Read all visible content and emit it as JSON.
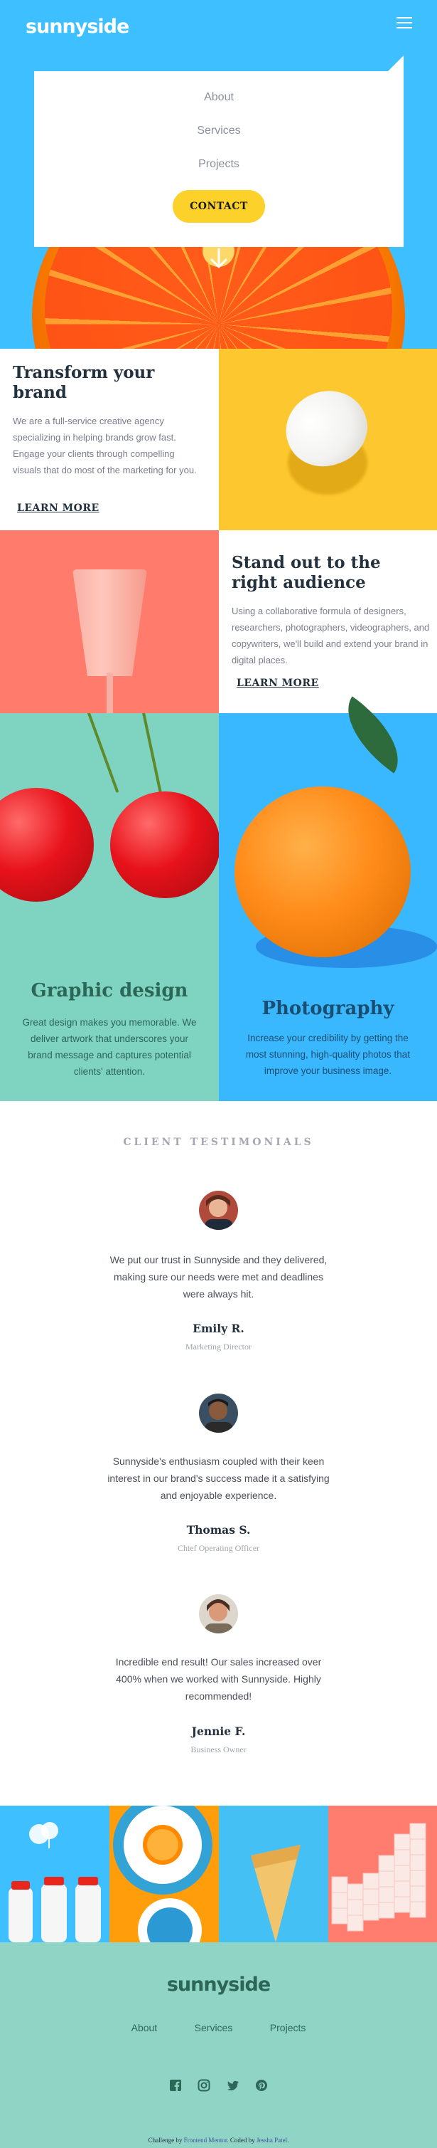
{
  "header": {
    "logo": "sunnyside",
    "menu_icon": "hamburger-icon"
  },
  "nav": {
    "items": [
      "About",
      "Services",
      "Projects"
    ],
    "contact": "CONTACT"
  },
  "hero": {
    "arrow_icon": "arrow-down-icon"
  },
  "features": [
    {
      "title": "Transform your brand",
      "body": "We are a full-service creative agency specializing in helping brands grow fast. Engage your clients through compelling visuals that do most of the marketing for you.",
      "cta": "LEARN MORE",
      "underline_color": "#fcd12a"
    },
    {
      "title": "Stand out to the right audience",
      "body": "Using a collaborative formula of designers, researchers, photographers, videographers, and copywriters, we'll build and extend your brand in digital places.",
      "cta": "LEARN MORE",
      "underline_color": "#ff7b6b"
    }
  ],
  "tiles": [
    {
      "title": "Graphic design",
      "body": "Great design makes you memorable. We deliver artwork that underscores your brand message and captures potential clients' attention.",
      "color": "#2c6657"
    },
    {
      "title": "Photography",
      "body": "Increase your credibility by getting the most stunning, high-quality photos that improve your business image.",
      "color": "#1a4e70"
    }
  ],
  "testimonials": {
    "heading": "CLIENT TESTIMONIALS",
    "items": [
      {
        "quote": "We put our trust in Sunnyside and they delivered, making sure our needs were met and deadlines were always hit.",
        "name": "Emily R.",
        "role": "Marketing Director"
      },
      {
        "quote": "Sunnyside's enthusiasm coupled with their keen interest in our brand's success made it a satisfying and enjoyable experience.",
        "name": "Thomas S.",
        "role": "Chief Operating Officer"
      },
      {
        "quote": "Incredible end result! Our sales increased over 400% when we worked with Sunnyside. Highly recommended!",
        "name": "Jennie F.",
        "role": "Business Owner"
      }
    ]
  },
  "footer": {
    "logo": "sunnyside",
    "links": [
      "About",
      "Services",
      "Projects"
    ],
    "social_icons": [
      "facebook-icon",
      "instagram-icon",
      "twitter-icon",
      "pinterest-icon"
    ],
    "attribution": {
      "prefix": "Challenge by",
      "challenge_link": "Frontend Mentor",
      "middle": ". Coded by",
      "author_link": "Jessha Patel",
      "suffix": "."
    }
  }
}
